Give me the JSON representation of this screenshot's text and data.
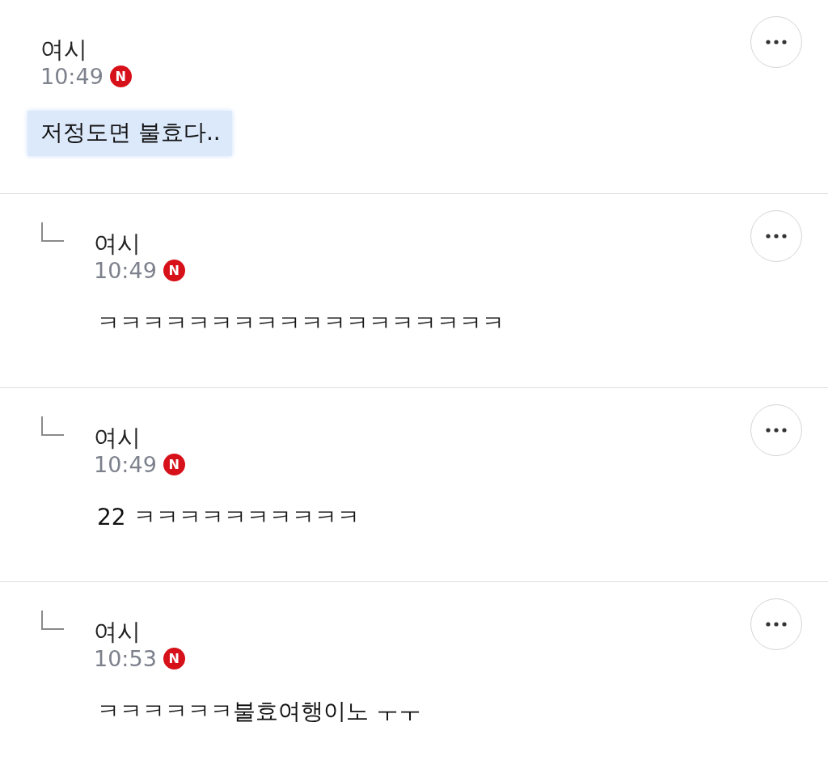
{
  "comments": [
    {
      "reply": false,
      "author": "여시",
      "time": "10:49",
      "badge": "N",
      "text": "저정도면 불효다..",
      "highlighted": true
    },
    {
      "reply": true,
      "author": "여시",
      "time": "10:49",
      "badge": "N",
      "text": "ㅋㅋㅋㅋㅋㅋㅋㅋㅋㅋㅋㅋㅋㅋㅋㅋㅋㅋ",
      "highlighted": false
    },
    {
      "reply": true,
      "author": "여시",
      "time": "10:49",
      "badge": "N",
      "text": "22 ㅋㅋㅋㅋㅋㅋㅋㅋㅋㅋ",
      "highlighted": false
    },
    {
      "reply": true,
      "author": "여시",
      "time": "10:53",
      "badge": "N",
      "text": "ㅋㅋㅋㅋㅋㅋ불효여행이노 ㅜㅜ",
      "highlighted": false
    }
  ]
}
